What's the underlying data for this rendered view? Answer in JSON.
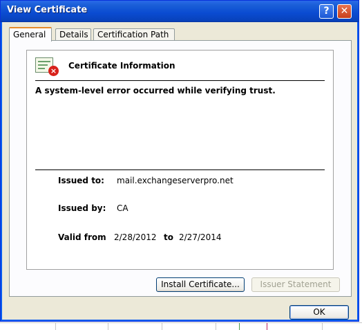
{
  "window": {
    "title": "View Certificate",
    "help_glyph": "?",
    "close_glyph": "✕"
  },
  "tabs": [
    {
      "label": "General",
      "active": true
    },
    {
      "label": "Details",
      "active": false
    },
    {
      "label": "Certification Path",
      "active": false
    }
  ],
  "general": {
    "section_title": "Certificate Information",
    "error_message": "A system-level error occurred while verifying trust.",
    "issued_to_label": "Issued to:",
    "issued_to_value": "mail.exchangeserverpro.net",
    "issued_by_label": "Issued by:",
    "issued_by_value": "CA",
    "valid_from_label": "Valid from",
    "valid_from_value": "2/28/2012",
    "valid_to_label": "to",
    "valid_to_value": "2/27/2014"
  },
  "buttons": {
    "install_certificate": "Install Certificate...",
    "issuer_statement": "Issuer Statement",
    "ok": "OK"
  },
  "colors": {
    "titlebar": "#0a4bd1",
    "dialog_bg": "#ece9d8",
    "active_tab_accent": "#e68b2c",
    "error_icon": "#d8211a"
  },
  "icons": {
    "certificate": "certificate-error-icon"
  }
}
